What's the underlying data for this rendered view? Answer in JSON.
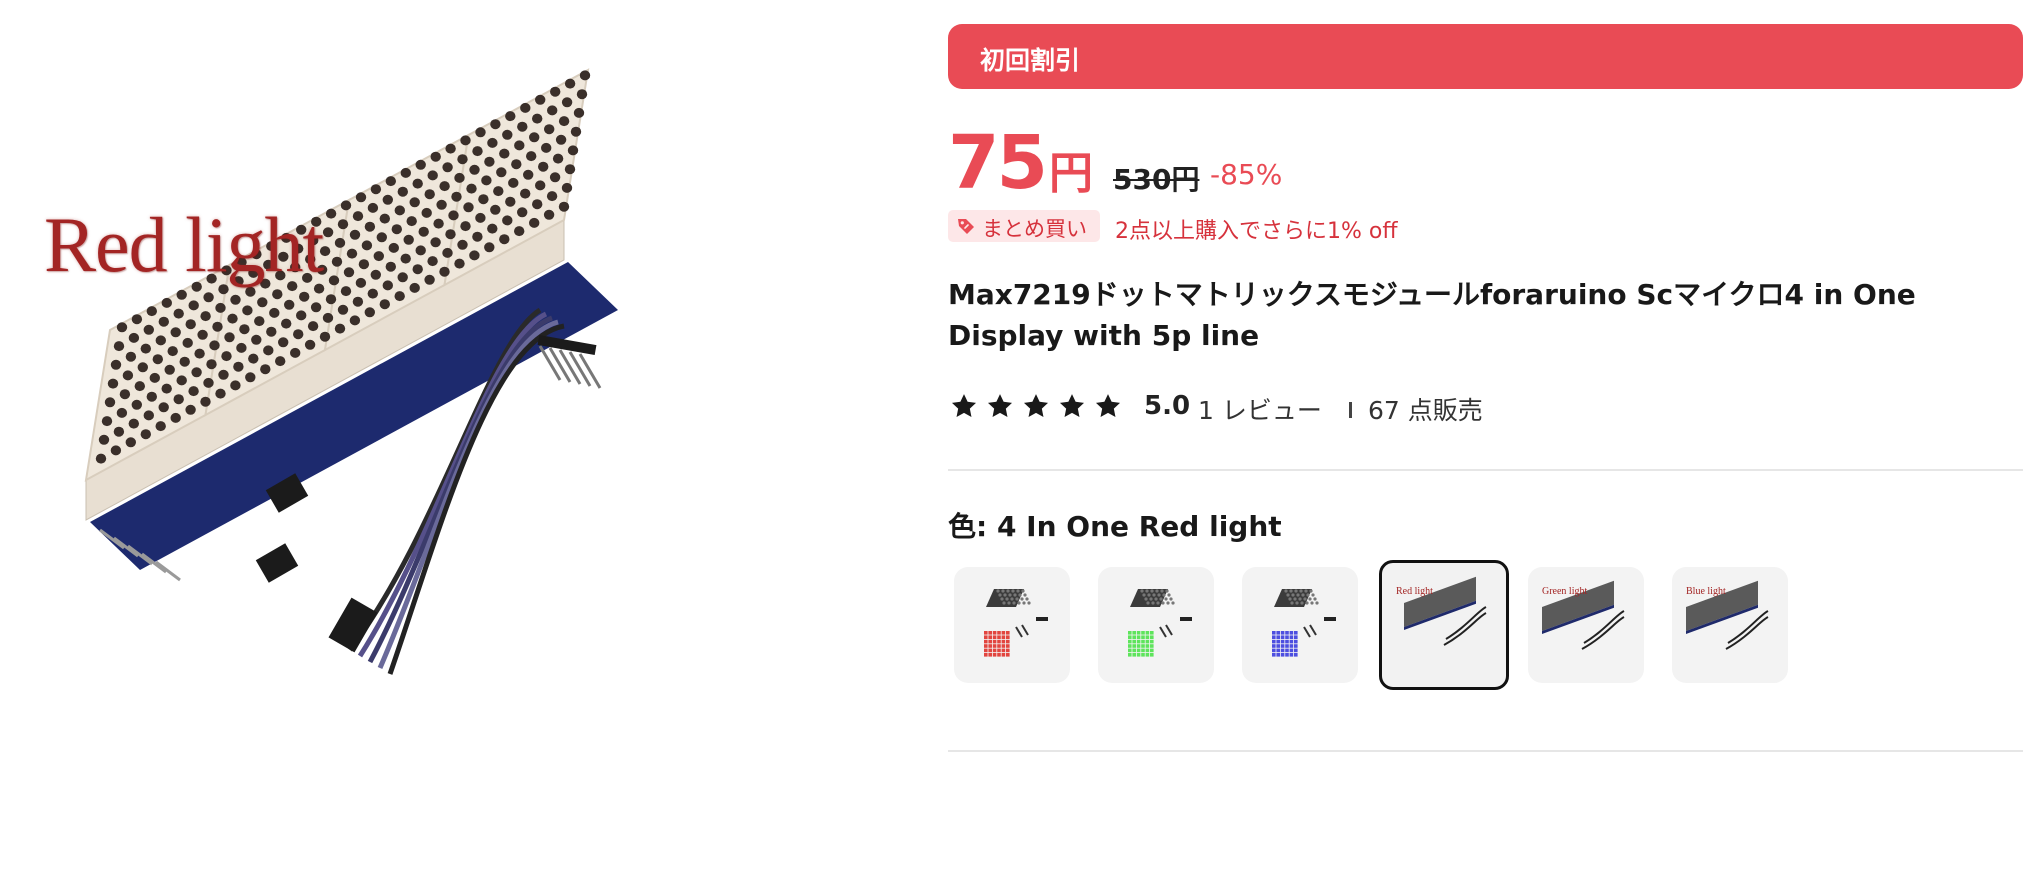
{
  "hero": {
    "caption": "Red light"
  },
  "promo": {
    "label": "初回割引"
  },
  "price": {
    "current": "75",
    "currency": "円",
    "original": "530円",
    "discount": "-85%"
  },
  "bulk": {
    "tag": "まとめ買い",
    "text": "2点以上購入でさらに1% off"
  },
  "product": {
    "title": "Max7219ドットマトリックスモジュールforaruino Scマイクロ4 in One Display with 5p line"
  },
  "rating": {
    "stars": 5,
    "value": "5.0",
    "reviews": "1 レビュー",
    "sold": "67 点販売"
  },
  "variant": {
    "label": "色: 4 In One Red light",
    "options": [
      {
        "name": "Red",
        "selected": false,
        "dot_color": "#e2453f"
      },
      {
        "name": "Green",
        "selected": false,
        "dot_color": "#5ee45c"
      },
      {
        "name": "Blue",
        "selected": false,
        "dot_color": "#4d4fe0"
      },
      {
        "name": "4 In One Red light",
        "caption": "Red light",
        "selected": true
      },
      {
        "name": "4 In One Green light",
        "caption": "Green light",
        "selected": false
      },
      {
        "name": "4 In One Blue light",
        "caption": "Blue light",
        "selected": false
      }
    ]
  },
  "colors": {
    "accent": "#e94b55",
    "accent_light": "#fde7e8",
    "discount_text": "#d6323c"
  }
}
